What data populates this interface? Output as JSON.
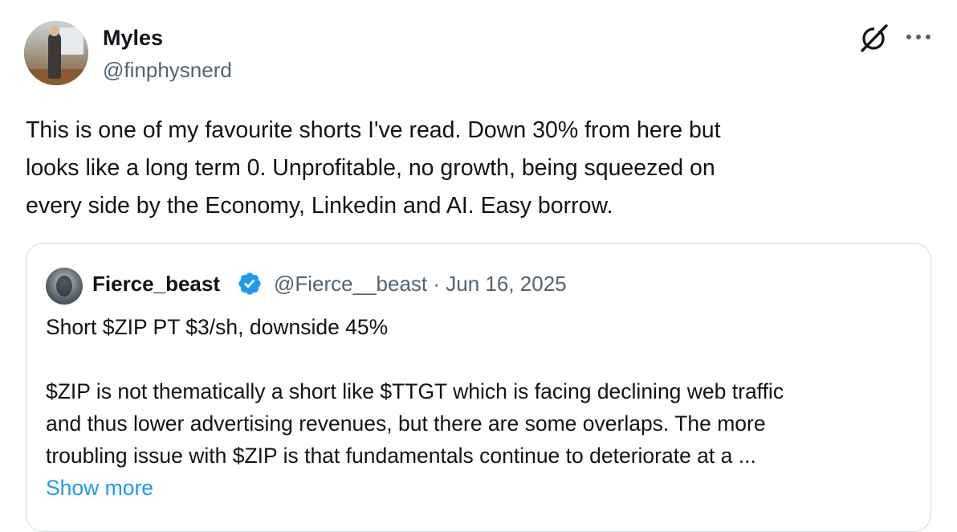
{
  "author": {
    "name": "Myles",
    "handle": "@finphysnerd",
    "avatar_icon": "profile-photo"
  },
  "actions": {
    "grok_icon": "grok-icon",
    "more_icon": "more-dots-icon"
  },
  "tweet": {
    "line1": "This is one of my favourite shorts I've read. Down 30% from here but",
    "line2": "looks like a long term 0. Unprofitable, no growth, being squeezed on",
    "line3": "every side by the Economy, Linkedin and AI. Easy borrow."
  },
  "quoted_tweet": {
    "name": "Fierce_beast",
    "verified_icon": "verified-badge-icon",
    "meta": "@Fierce__beast · Jun 16, 2025",
    "line1": "Short $ZIP PT $3/sh, downside  45%",
    "line2": "$ZIP is not thematically a short like $TTGT which is facing declining web traffic",
    "line3": "and thus lower advertising revenues, but there are some overlaps. The more",
    "line4": "troubling issue with $ZIP is that fundamentals continue to deteriorate at a ...",
    "show_more": "Show more"
  },
  "colors": {
    "text": "#0f1419",
    "secondary": "#536471",
    "link": "#1d9bf0",
    "border": "#cfd9de"
  }
}
